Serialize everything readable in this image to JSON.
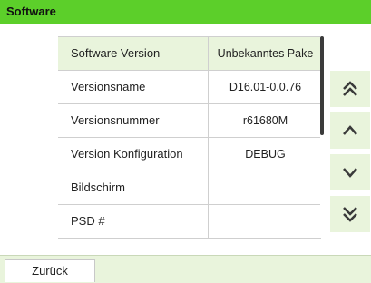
{
  "header": {
    "title": "Software"
  },
  "table": {
    "rows": [
      {
        "label": "Software Version",
        "value": "Unbekanntes Pake"
      },
      {
        "label": "Versionsname",
        "value": "D16.01-0.0.76"
      },
      {
        "label": "Versionsnummer",
        "value": "r61680M"
      },
      {
        "label": "Version Konfiguration",
        "value": "DEBUG"
      },
      {
        "label": "Bildschirm",
        "value": ""
      },
      {
        "label": "PSD #",
        "value": ""
      }
    ]
  },
  "nav": {
    "page_up_icon": "double-chevron-up-icon",
    "line_up_icon": "chevron-up-icon",
    "line_down_icon": "chevron-down-icon",
    "page_down_icon": "double-chevron-down-icon"
  },
  "footer": {
    "back_label": "Zurück"
  },
  "colors": {
    "title_bar": "#5ccf2a",
    "light_green": "#e9f4dc",
    "icon": "#3a3a3a"
  }
}
